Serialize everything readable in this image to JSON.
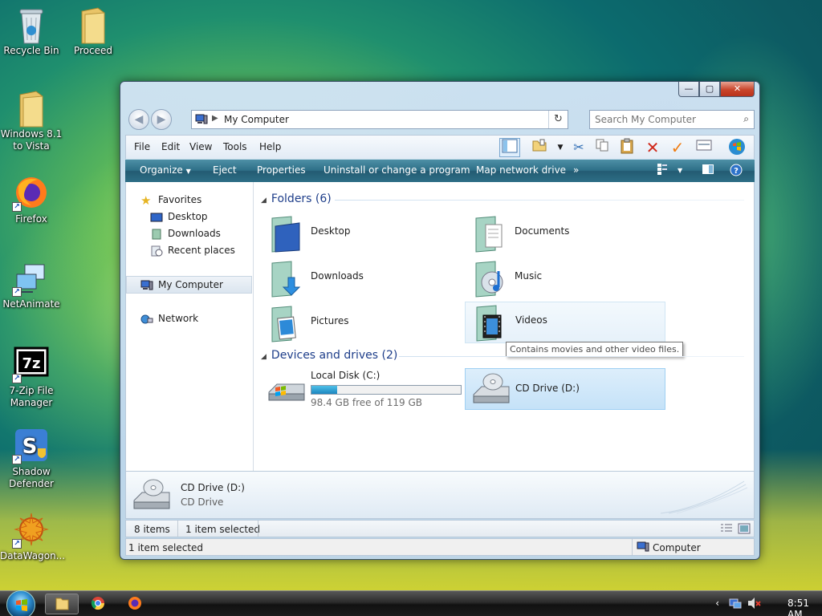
{
  "desktop": {
    "icons": [
      {
        "label": "Recycle Bin"
      },
      {
        "label": "Proceed"
      },
      {
        "label": "Windows 8.1 to Vista"
      },
      {
        "label": "Firefox"
      },
      {
        "label": "NetAnimate"
      },
      {
        "label": "7-Zip File Manager"
      },
      {
        "label": "Shadow Defender"
      },
      {
        "label": "DataWagon..."
      }
    ]
  },
  "window": {
    "caption_buttons": {
      "minimize": "—",
      "maximize": "▢",
      "close": "✕"
    },
    "address": {
      "path": "My Computer"
    },
    "search": {
      "placeholder": "Search My Computer"
    },
    "menu": [
      "File",
      "Edit",
      "View",
      "Tools",
      "Help"
    ],
    "commands": [
      "Organize",
      "Eject",
      "Properties",
      "Uninstall or change a program",
      "Map network drive",
      "»"
    ],
    "nav": {
      "favorites": "Favorites",
      "favorites_items": [
        "Desktop",
        "Downloads",
        "Recent places"
      ],
      "my_computer": "My Computer",
      "network": "Network"
    },
    "folders_group": "Folders (6)",
    "folders": [
      "Desktop",
      "Documents",
      "Downloads",
      "Music",
      "Pictures",
      "Videos"
    ],
    "tooltip": "Contains movies and other video files.",
    "devices_group": "Devices and drives (2)",
    "local_disk": {
      "name": "Local Disk (C:)",
      "free_text": "98.4 GB free of 119 GB",
      "used_fraction": 0.17
    },
    "cd_drive": {
      "name": "CD Drive (D:)"
    },
    "details": {
      "name": "CD Drive (D:)",
      "type": "CD Drive"
    },
    "status": {
      "items": "8 items",
      "selected": "1 item selected"
    },
    "status2": {
      "selected": "1 item selected",
      "zone": "Computer"
    }
  },
  "taskbar": {
    "time": "8:51 AM"
  }
}
